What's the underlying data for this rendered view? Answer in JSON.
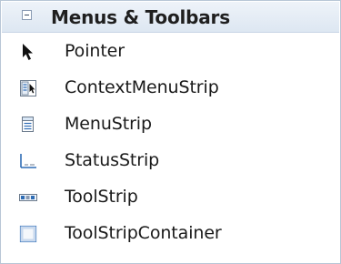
{
  "toolbox": {
    "group_title": "Menus & Toolbars",
    "items": [
      {
        "label": "Pointer",
        "icon": "pointer-icon"
      },
      {
        "label": "ContextMenuStrip",
        "icon": "context-menu-strip-icon"
      },
      {
        "label": "MenuStrip",
        "icon": "menu-strip-icon"
      },
      {
        "label": "StatusStrip",
        "icon": "status-strip-icon"
      },
      {
        "label": "ToolStrip",
        "icon": "tool-strip-icon"
      },
      {
        "label": "ToolStripContainer",
        "icon": "tool-strip-container-icon"
      }
    ]
  },
  "colors": {
    "header_gradient_top": "#eef3f9",
    "header_gradient_bottom": "#dde7f2",
    "border": "#b8c6d6",
    "icon_blue": "#2f6db5"
  }
}
